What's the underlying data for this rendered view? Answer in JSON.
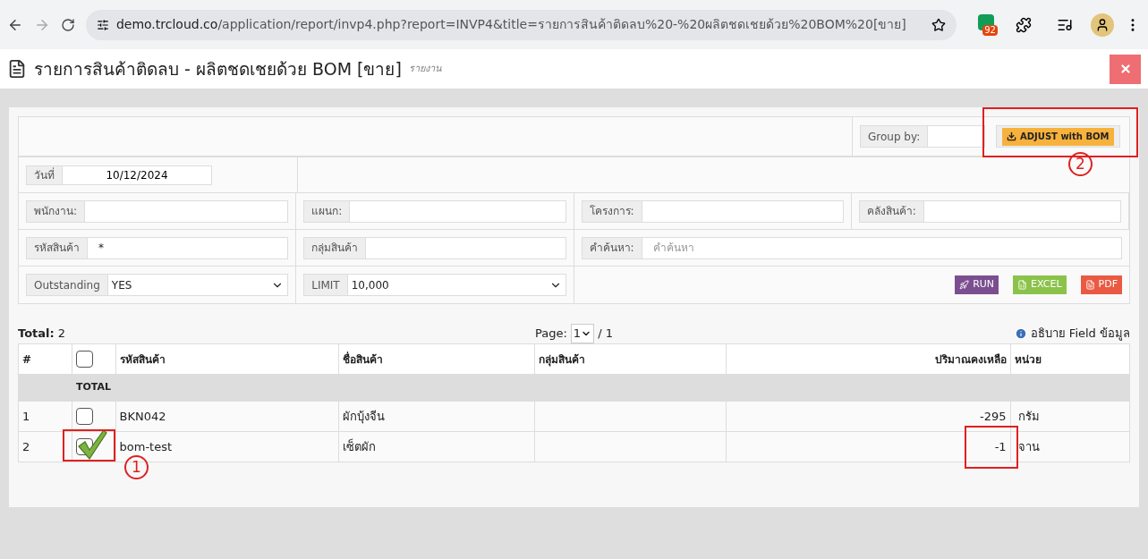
{
  "browser": {
    "url_host": "demo.trcloud.co",
    "url_path": "/application/report/invp4.php?report=INVP4&title=รายการสินค้าติดลบ%20-%20ผลิตชดเชยด้วย%20BOM%20[ขาย]",
    "extension_badge": "92"
  },
  "page": {
    "title": "รายการสินค้าติดลบ - ผลิตชดเชยด้วย BOM [ขาย]",
    "subtitle": "รายงาน"
  },
  "filters": {
    "group_by": {
      "label": "Group by:"
    },
    "adjust_button": "ADJUST with BOM",
    "date": {
      "label": "วันที่",
      "value": "10/12/2024"
    },
    "rows": [
      [
        {
          "kind": "text",
          "label": "พนักงาน:"
        },
        {
          "kind": "text",
          "label": "แผนก:"
        },
        {
          "kind": "text",
          "label": "โครงการ:"
        },
        {
          "kind": "text",
          "label": "คลังสินค้า:"
        }
      ],
      [
        {
          "kind": "text",
          "label": "รหัสสินค้า",
          "value": "*"
        },
        {
          "kind": "text",
          "label": "กลุ่มสินค้า"
        },
        {
          "kind": "search",
          "label": "คำค้นหา:",
          "placeholder": "คำค้นหา"
        }
      ],
      [
        {
          "kind": "select",
          "label": "Outstanding",
          "value": "YES"
        },
        {
          "kind": "select",
          "label": "LIMIT",
          "value": "10,000"
        }
      ]
    ],
    "actions": [
      {
        "kind": "run",
        "label": "RUN"
      },
      {
        "kind": "excel",
        "label": "EXCEL"
      },
      {
        "kind": "pdf",
        "label": "PDF"
      }
    ]
  },
  "summary": {
    "total_label": "Total:",
    "total_value": "2",
    "page_label": "Page:",
    "page_value": "1",
    "page_of": "/ 1",
    "help": "อธิบาย Field ข้อมูล"
  },
  "table": {
    "columns": [
      {
        "kind": "text",
        "label": "#"
      },
      {
        "kind": "checkbox",
        "checked": false
      },
      {
        "kind": "text",
        "label": "รหัสสินค้า"
      },
      {
        "kind": "text",
        "label": "ชื่อสินค้า"
      },
      {
        "kind": "text",
        "label": "กลุ่มสินค้า"
      },
      {
        "kind": "text",
        "label": "ปริมาณคงเหลือ"
      },
      {
        "kind": "text",
        "label": "หน่วย"
      }
    ],
    "total_label": "TOTAL",
    "rows": [
      {
        "number": "1",
        "checked": false,
        "code": "BKN042",
        "name": "ผักบุ้งจีน",
        "qty": "-295",
        "unit": "กรัม"
      },
      {
        "number": "2",
        "checked": true,
        "code": "bom-test",
        "name": "เซ็ตผัก",
        "qty": "-1",
        "unit": "จาน"
      }
    ]
  },
  "annotations": [
    {
      "label": "1"
    },
    {
      "label": "2"
    }
  ]
}
